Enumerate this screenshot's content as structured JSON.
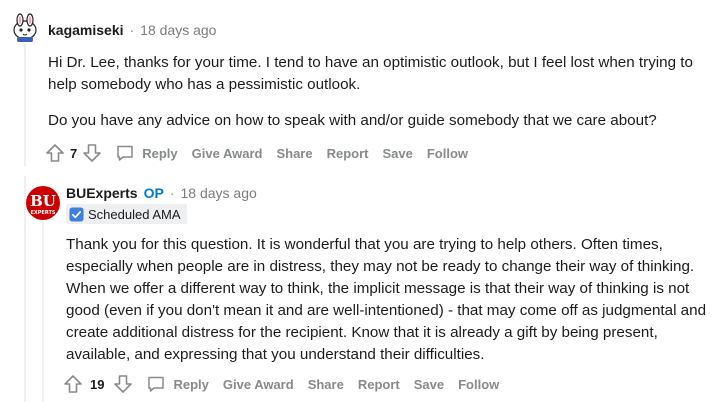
{
  "comments": [
    {
      "username": "kagamiseki",
      "separator": "·",
      "time": "18 days ago",
      "paragraphs": [
        "Hi Dr. Lee, thanks for your time. I tend to have an optimistic outlook, but I feel lost when trying to help somebody who has a pessimistic outlook.",
        "Do you have any advice on how to speak with and/or guide somebody that we care about?"
      ],
      "votes": "7",
      "actions": {
        "reply": "Reply",
        "give_award": "Give Award",
        "share": "Share",
        "report": "Report",
        "save": "Save",
        "follow": "Follow"
      },
      "avatar_icon": "snoo-avatar-icon"
    },
    {
      "username": "BUExperts",
      "op": "OP",
      "separator": "·",
      "time": "18 days ago",
      "flair": "Scheduled AMA",
      "paragraphs": [
        "Thank you for this question. It is wonderful that you are trying to help others. Often times, especially when people are in distress, they may not be ready to change their way of thinking. When we offer a different way to think, the implicit message is that their way of thinking is not good (even if you don't mean it and are well-intentioned) - that may come off as judgmental and create additional distress for the recipient. Know that it is already a gift by being present, available, and expressing that you understand their difficulties."
      ],
      "votes": "19",
      "actions": {
        "reply": "Reply",
        "give_award": "Give Award",
        "share": "Share",
        "report": "Report",
        "save": "Save",
        "follow": "Follow"
      },
      "avatar_text": "BU",
      "avatar_subtext": "EXPERTS"
    }
  ],
  "colors": {
    "op": "#0079d3",
    "action_text": "#878a8c",
    "bu_red": "#cc0000",
    "verified_blue": "#3f7fe0"
  }
}
